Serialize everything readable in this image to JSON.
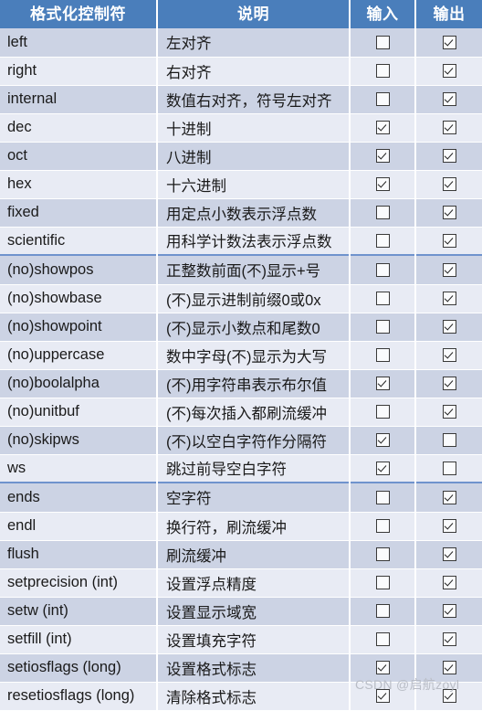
{
  "table": {
    "columns": [
      {
        "key": "name",
        "label": "格式化控制符"
      },
      {
        "key": "desc",
        "label": "说明"
      },
      {
        "key": "input",
        "label": "输入"
      },
      {
        "key": "output",
        "label": "输出"
      }
    ],
    "header_bg": "#4a7ebb",
    "header_color": "#ffffff",
    "row_band_dark": "#ccd3e4",
    "row_band_light": "#e8ebf4",
    "accent_color": "#6f93cd",
    "rows": [
      {
        "name": "left",
        "desc": "左对齐",
        "input": false,
        "output": true,
        "band": "dark",
        "accent": false
      },
      {
        "name": "right",
        "desc": "右对齐",
        "input": false,
        "output": true,
        "band": "light",
        "accent": false
      },
      {
        "name": "internal",
        "desc": "数值右对齐，符号左对齐",
        "input": false,
        "output": true,
        "band": "dark",
        "accent": false
      },
      {
        "name": "dec",
        "desc": "十进制",
        "input": true,
        "output": true,
        "band": "light",
        "accent": false
      },
      {
        "name": "oct",
        "desc": "八进制",
        "input": true,
        "output": true,
        "band": "dark",
        "accent": false
      },
      {
        "name": "hex",
        "desc": "十六进制",
        "input": true,
        "output": true,
        "band": "light",
        "accent": false
      },
      {
        "name": "fixed",
        "desc": "用定点小数表示浮点数",
        "input": false,
        "output": true,
        "band": "dark",
        "accent": false
      },
      {
        "name": "scientific",
        "desc": "用科学计数法表示浮点数",
        "input": false,
        "output": true,
        "band": "light",
        "accent": false
      },
      {
        "name": "(no)showpos",
        "desc": "正整数前面(不)显示+号",
        "input": false,
        "output": true,
        "band": "dark",
        "accent": true
      },
      {
        "name": "(no)showbase",
        "desc": "(不)显示进制前缀0或0x",
        "input": false,
        "output": true,
        "band": "light",
        "accent": false
      },
      {
        "name": "(no)showpoint",
        "desc": "(不)显示小数点和尾数0",
        "input": false,
        "output": true,
        "band": "dark",
        "accent": false
      },
      {
        "name": "(no)uppercase",
        "desc": "数中字母(不)显示为大写",
        "input": false,
        "output": true,
        "band": "light",
        "accent": false
      },
      {
        "name": "(no)boolalpha",
        "desc": "(不)用字符串表示布尔值",
        "input": true,
        "output": true,
        "band": "dark",
        "accent": false
      },
      {
        "name": "(no)unitbuf",
        "desc": "(不)每次插入都刷流缓冲",
        "input": false,
        "output": true,
        "band": "light",
        "accent": false
      },
      {
        "name": "(no)skipws",
        "desc": "(不)以空白字符作分隔符",
        "input": true,
        "output": false,
        "band": "dark",
        "accent": false
      },
      {
        "name": "ws",
        "desc": "跳过前导空白字符",
        "input": true,
        "output": false,
        "band": "light",
        "accent": false
      },
      {
        "name": "ends",
        "desc": "空字符",
        "input": false,
        "output": true,
        "band": "dark",
        "accent": true
      },
      {
        "name": "endl",
        "desc": "换行符，刷流缓冲",
        "input": false,
        "output": true,
        "band": "light",
        "accent": false
      },
      {
        "name": "flush",
        "desc": "刷流缓冲",
        "input": false,
        "output": true,
        "band": "dark",
        "accent": false
      },
      {
        "name": "setprecision (int)",
        "desc": "设置浮点精度",
        "input": false,
        "output": true,
        "band": "light",
        "accent": false
      },
      {
        "name": "setw (int)",
        "desc": "设置显示域宽",
        "input": false,
        "output": true,
        "band": "dark",
        "accent": false
      },
      {
        "name": "setfill (int)",
        "desc": "设置填充字符",
        "input": false,
        "output": true,
        "band": "light",
        "accent": false
      },
      {
        "name": "setiosflags (long)",
        "desc": "设置格式标志",
        "input": true,
        "output": true,
        "band": "dark",
        "accent": false
      },
      {
        "name": "resetiosflags (long)",
        "desc": "清除格式标志",
        "input": true,
        "output": true,
        "band": "light",
        "accent": false
      }
    ]
  },
  "watermark": {
    "text": "CSDN @启航zoyl"
  }
}
